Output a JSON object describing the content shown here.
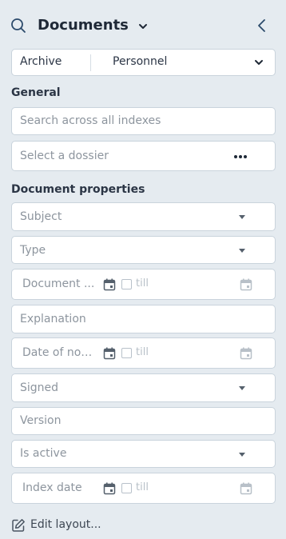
{
  "header": {
    "title": "Documents"
  },
  "archive": {
    "label": "Archive",
    "value": "Personnel"
  },
  "general": {
    "heading": "General",
    "search_placeholder": "Search across all indexes",
    "dossier_placeholder": "Select a dossier"
  },
  "properties": {
    "heading": "Document properties",
    "subject": "Subject",
    "type": "Type",
    "document_date": "Document ...",
    "explanation": "Explanation",
    "date_of_notice": "Date of not...",
    "signed": "Signed",
    "version": "Version",
    "is_active": "Is active",
    "index_date": "Index date",
    "till_label": "till"
  },
  "footer": {
    "edit_layout": "Edit layout..."
  },
  "colors": {
    "background": "#e5ebf0",
    "accent": "#2b4a6b",
    "border": "#c9d3dc"
  },
  "icons": [
    "search-icon",
    "chevron-down-icon",
    "chevron-left-icon",
    "more-horizontal-icon",
    "caret-down-icon",
    "calendar-icon",
    "checkbox-icon",
    "edit-icon"
  ]
}
